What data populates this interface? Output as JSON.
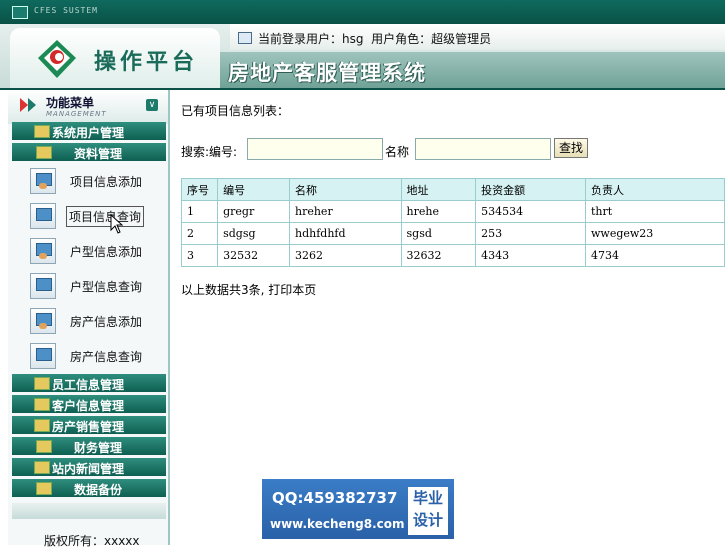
{
  "window": {
    "title": "CFES SUSTEM"
  },
  "header": {
    "logo_text": "操作平台",
    "user_info": "当前登录用户：hsg  用户角色：超级管理员",
    "system_title": "房地产客服管理系统"
  },
  "sidebar": {
    "menu_title": "功能菜单",
    "menu_subtitle": "MANAGEMENT",
    "categories_top": [
      {
        "label": "系统用户管理"
      },
      {
        "label": "资料管理"
      }
    ],
    "sub_items": [
      {
        "label": "项目信息添加"
      },
      {
        "label": "项目信息查询"
      },
      {
        "label": "户型信息添加"
      },
      {
        "label": "户型信息查询"
      },
      {
        "label": "房产信息添加"
      },
      {
        "label": "房产信息查询"
      }
    ],
    "categories_bottom": [
      {
        "label": "员工信息管理"
      },
      {
        "label": "客户信息管理"
      },
      {
        "label": "房产销售管理"
      },
      {
        "label": "财务管理"
      },
      {
        "label": "站内新闻管理"
      },
      {
        "label": "数据备份"
      }
    ],
    "copyright": "版权所有：xxxxx"
  },
  "main": {
    "list_title": "已有项目信息列表：",
    "search_label": "搜索:编号:",
    "search_code_value": "",
    "name_label": "名称",
    "search_name_value": "",
    "search_button": "查找",
    "table": {
      "headers": [
        "序号",
        "编号",
        "名称",
        "地址",
        "投资金额",
        "负责人"
      ],
      "rows": [
        [
          "1",
          "gregr",
          "hreher",
          "hrehe",
          "534534",
          "thrt"
        ],
        [
          "2",
          "sdgsg",
          "hdhfdhfd",
          "sgsd",
          "253",
          "wwegew23"
        ],
        [
          "3",
          "32532",
          "3262",
          "32632",
          "4343",
          "4734"
        ]
      ]
    },
    "summary": "以上数据共3条, 打印本页"
  },
  "watermark": {
    "qq": "QQ:459382737",
    "site": "www.kecheng8.com",
    "tag_line1": "毕业",
    "tag_line2": "设计"
  }
}
